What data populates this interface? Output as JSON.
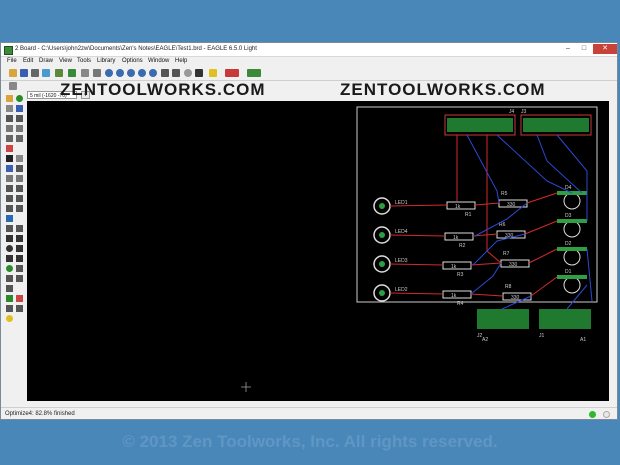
{
  "window": {
    "title": "2 Board - C:\\Users\\john2zw\\Documents\\Zen's Notes\\EAGLE\\Test1.brd - EAGLE 6.5.0 Light",
    "minimize": "–",
    "maximize": "□",
    "close": "✕"
  },
  "menu": {
    "items": [
      "File",
      "Edit",
      "Draw",
      "View",
      "Tools",
      "Library",
      "Options",
      "Window",
      "Help"
    ]
  },
  "coordinates": {
    "value": "5 mil (-1620 -70)"
  },
  "watermarks": [
    "ZENTOOLWORKS.COM",
    "ZENTOOLWORKS.COM"
  ],
  "board": {
    "labels": {
      "q4": "LED1",
      "q3": "LED4",
      "q2": "LED3",
      "q1": "LED2",
      "j1": "J1",
      "j2": "J2",
      "j3": "J3",
      "j4": "J4",
      "r1": "R1",
      "r2": "R2",
      "r3": "R3",
      "r4": "R4",
      "r5": "R5",
      "r6": "R6",
      "r7": "R7",
      "r8": "R8",
      "v1": "1k",
      "v2": "1k",
      "v3": "1k",
      "v4": "1k",
      "v5": "330",
      "v6": "330",
      "v7": "330",
      "v8": "330",
      "d1": "D1",
      "d2": "D2",
      "d3": "D3",
      "d4": "D4",
      "a1": "A1",
      "a2": "A2"
    }
  },
  "status": {
    "text": "Optimize4: 82.8% finished"
  },
  "footer": {
    "copyright": "© 2013 Zen Toolworks, Inc. All rights reserved."
  },
  "colors": {
    "canvas": "#000000",
    "outline": "#cccccc",
    "pad": "#2ea043",
    "top_trace": "#d42a2a",
    "bottom_trace": "#2a4ad4",
    "status_ok": "#2eb82e"
  }
}
